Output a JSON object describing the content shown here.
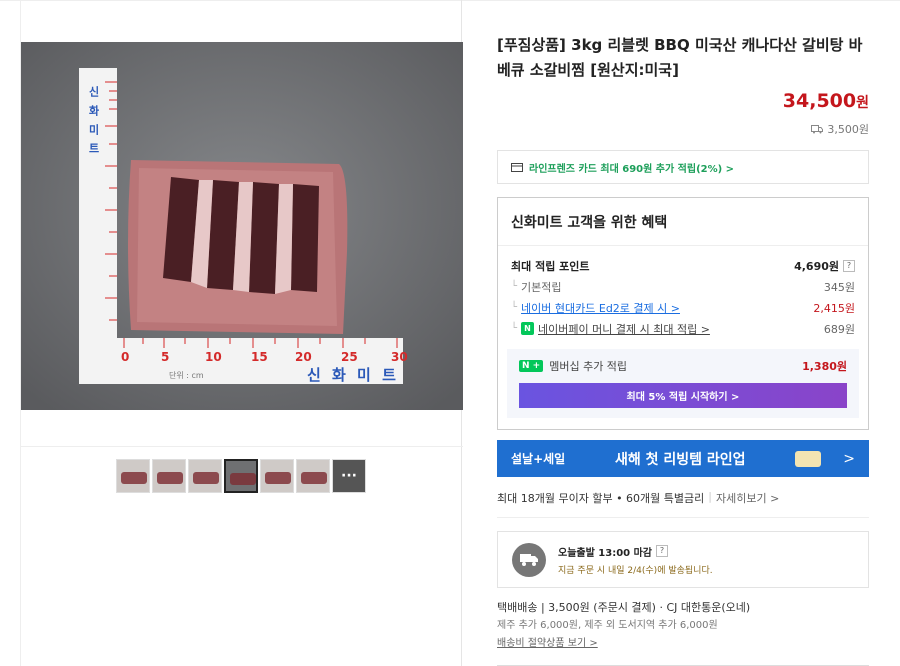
{
  "product": {
    "title": "[푸짐상품] 3kg 리블렛 BBQ 미국산 캐나다산 갈비탕 바베큐 소갈비찜 [원산지:미국]",
    "price": "34,500",
    "price_unit": "원",
    "shipping_fee": "3,500원"
  },
  "photo": {
    "ruler_brand": "신 화 미 트",
    "ruler_vertical_brand": "신 화 미 트",
    "ruler_unit": "단위 : cm",
    "ticks": [
      "0",
      "5",
      "10",
      "15",
      "20",
      "25",
      "30"
    ]
  },
  "thumbnails": {
    "count": 7,
    "active_index": 3,
    "more_label": "···"
  },
  "card_banner": {
    "text": "라인프렌즈 카드 최대 690원 추가 적립(2%) >"
  },
  "benefit": {
    "title": "신화미트 고객을 위한 혜택",
    "max_points_label": "최대 적립 포인트",
    "max_points_value": "4,690원",
    "help": "?",
    "rows": [
      {
        "label": "기본적립",
        "value": "345원"
      },
      {
        "label": "네이버 현대카드 Ed2로 결제 시 >",
        "value": "2,415원"
      },
      {
        "label": "네이버페이 머니 결제 시 최대 적립 >",
        "value": "689원"
      }
    ],
    "npay_badge": "N",
    "membership_badge": "N +",
    "membership_label": "멤버십 추가 적립",
    "membership_value": "1,380원",
    "cta": "최대 5% 적립 시작하기 >"
  },
  "promo": {
    "tag": "설날+세일",
    "text": "새해 첫 리빙템 라인업",
    "chevron": ">"
  },
  "installment": {
    "text": "최대 18개월 무이자 할부 • 60개월 특별금리",
    "sep": "|",
    "more": "자세히보기 >"
  },
  "delivery": {
    "line1": "오늘출발 13:00 마감",
    "help": "?",
    "line2": "지금 주문 시 내일 2/4(수)에 발송됩니다."
  },
  "shipping": {
    "line1": "택배배송 | 3,500원 (주문시 결제) · CJ 대한통운(오네)",
    "line2": "제주 추가 6,000원, 제주 외 도서지역 추가 6,000원",
    "line3": "배송비 절약상품 보기 >"
  },
  "colors": {
    "price_red": "#c4161c",
    "npay_green": "#03c75a",
    "promo_blue": "#1f6fd0",
    "cta_purple": "#7a4ad6"
  }
}
